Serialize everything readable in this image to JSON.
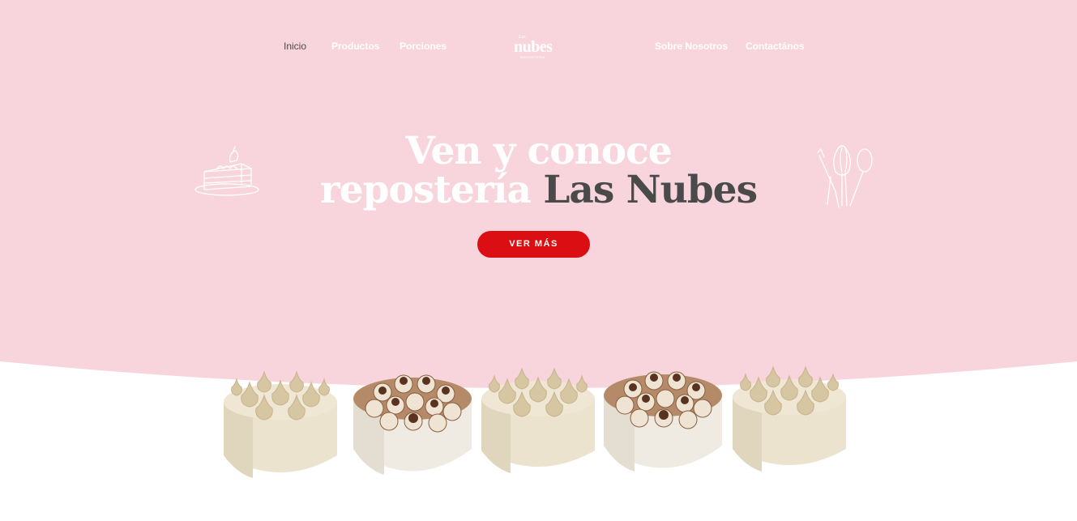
{
  "nav": {
    "items": [
      {
        "label": "Inicio",
        "active": true
      },
      {
        "label": "Productos",
        "active": false
      },
      {
        "label": "Porciones",
        "active": false
      },
      {
        "label": "Sobre Nosotros",
        "active": false
      },
      {
        "label": "Contactános",
        "active": false
      }
    ]
  },
  "logo": {
    "small": "Las",
    "main": "nubes",
    "tagline": "REPOSTERÍA"
  },
  "hero": {
    "line1": "Ven y conoce",
    "line2_prefix": "repostería",
    "line2_brand": "Las Nubes",
    "cta_label": "VER MÁS"
  },
  "icons": {
    "left": "cake-slice-icon",
    "right": "kitchen-utensils-icon"
  },
  "cakes": [
    "meringue-cake",
    "tiramisu-cake",
    "meringue-cake",
    "tiramisu-cake",
    "meringue-cake"
  ],
  "colors": {
    "hero_background": "#f8d5dc",
    "brand_text": "#4a4a4a",
    "cta_background": "#db0e13",
    "white": "#ffffff"
  }
}
